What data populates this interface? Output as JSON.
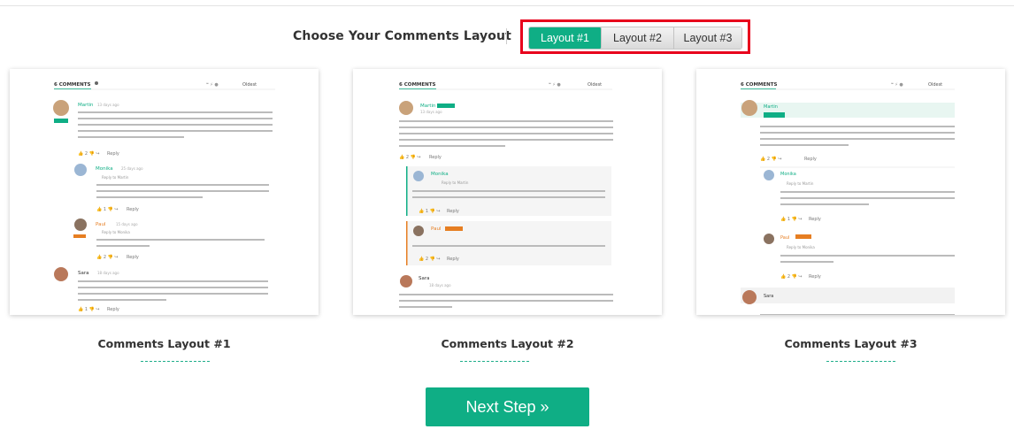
{
  "header": {
    "choose_label": "Choose Your Comments Layout"
  },
  "layout_buttons": [
    {
      "label": "Layout #1",
      "active": true
    },
    {
      "label": "Layout #2",
      "active": false
    },
    {
      "label": "Layout #3",
      "active": false
    }
  ],
  "previews": [
    {
      "caption": "Comments Layout #1"
    },
    {
      "caption": "Comments Layout #2"
    },
    {
      "caption": "Comments Layout #3"
    }
  ],
  "preview_text": {
    "count": "6 COMMENTS",
    "sort": "Oldest",
    "author1": "Martin",
    "author2": "Monika",
    "author3": "Paul",
    "author4": "Sara",
    "badge": "Author",
    "reply": "Reply",
    "time1": "13 days ago",
    "time2": "25 days ago",
    "time3": "15 days ago",
    "time4": "18 days ago",
    "reply_to_martin": "Reply to Martin",
    "reply_to_monika": "Reply to Monika",
    "v_up1": "2",
    "v_up2": "1",
    "v_up3": "2",
    "v_up4": "1"
  },
  "colors": {
    "accent": "#0fae85",
    "highlight": "#e8001c",
    "paul": "#e67e22"
  },
  "next": {
    "label": "Next Step »"
  }
}
